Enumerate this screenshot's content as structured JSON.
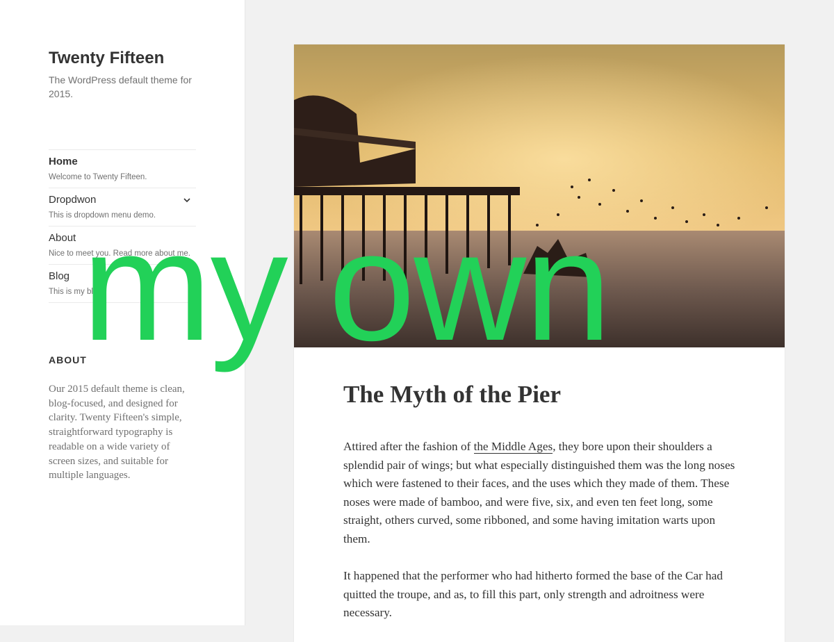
{
  "site": {
    "title": "Twenty Fifteen",
    "description": "The WordPress default theme for 2015."
  },
  "nav": {
    "items": [
      {
        "label": "Home",
        "description": "Welcome to Twenty Fifteen.",
        "current": true
      },
      {
        "label": "Dropdwon",
        "description": "This is dropdown menu demo.",
        "has_dropdown": true,
        "dropdown_icon": "chevron-down-icon"
      },
      {
        "label": "About",
        "description": "Nice to meet you. Read more about me."
      },
      {
        "label": "Blog",
        "description": "This is my blog."
      }
    ]
  },
  "widget": {
    "heading": "ABOUT",
    "text": "Our 2015 default theme is clean, blog-focused, and designed for clarity. Twenty Fifteen's simple, straightforward typography is readable on a wide variety of screen sizes, and suitable for multiple languages."
  },
  "post": {
    "title": "The Myth of the Pier",
    "para1_before": "Attired after the fashion of ",
    "para1_link": "the Middle Ages",
    "para1_after": ", they bore upon their shoulders a splendid pair of wings; but what especially distinguished them was the long noses which were fastened to their faces, and the uses which they made of them. These noses were made of bamboo, and were five, six, and even ten feet long, some straight, others curved, some ribboned, and some having imitation warts upon them.",
    "para2": "It happened that the performer who had hitherto formed the base of the Car had quitted the troupe, and as, to fill this part, only strength and adroitness were necessary."
  },
  "overlay": {
    "text": "my own",
    "color": "#22d158"
  },
  "colors": {
    "sidebar_bg": "#ffffff",
    "page_bg": "#f1f1f1",
    "text": "#333333",
    "muted_text": "#707070"
  }
}
